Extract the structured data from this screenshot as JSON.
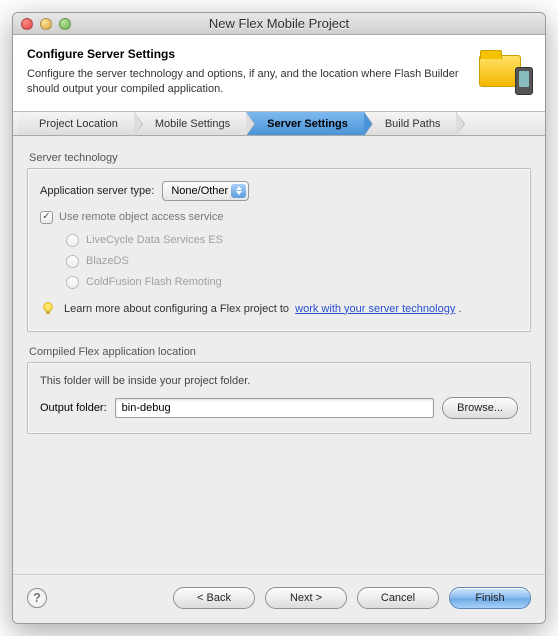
{
  "window": {
    "title": "New Flex Mobile Project"
  },
  "banner": {
    "heading": "Configure Server Settings",
    "desc": "Configure the server technology and options, if any, and the location where Flash Builder should output your compiled application."
  },
  "tabs": {
    "t0": "Project Location",
    "t1": "Mobile Settings",
    "t2": "Server Settings",
    "t3": "Build Paths"
  },
  "server": {
    "group_label": "Server technology",
    "type_label": "Application server type:",
    "type_value": "None/Other",
    "remote_label": "Use remote object access service",
    "opt_lcds": "LiveCycle Data Services ES",
    "opt_blaze": "BlazeDS",
    "opt_cf": "ColdFusion Flash Remoting",
    "hint_prefix": "Learn more about configuring a Flex project to",
    "hint_link": "work with your server technology",
    "hint_suffix": "."
  },
  "output": {
    "group_label": "Compiled Flex application location",
    "note": "This folder will be inside your project folder.",
    "label": "Output folder:",
    "value": "bin-debug",
    "browse": "Browse..."
  },
  "footer": {
    "back": "< Back",
    "next": "Next >",
    "cancel": "Cancel",
    "finish": "Finish"
  }
}
